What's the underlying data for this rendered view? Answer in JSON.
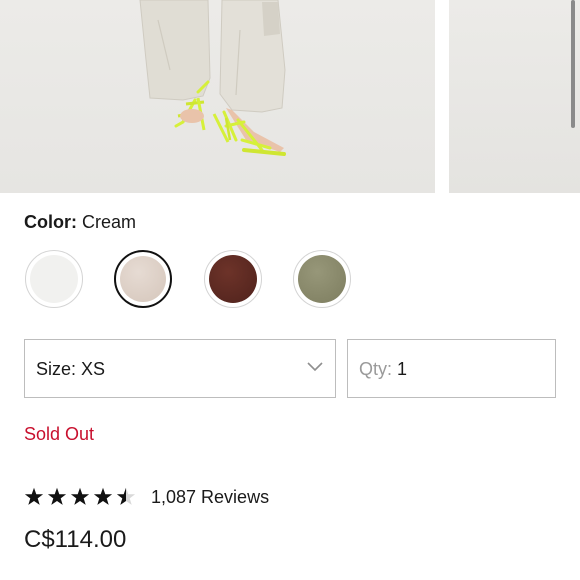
{
  "product": {
    "color_label": "Color:",
    "color_value": "Cream",
    "swatches": [
      {
        "name": "white",
        "color": "#f1f1ef"
      },
      {
        "name": "cream",
        "color": "#ddd0c7",
        "selected": true
      },
      {
        "name": "brown",
        "color": "#5c2a22"
      },
      {
        "name": "olive",
        "color": "#8a8a6c"
      }
    ],
    "size_label": "Size:",
    "size_value": "XS",
    "qty_label": "Qty:",
    "qty_value": "1",
    "status": "Sold Out",
    "rating": 4.5,
    "reviews": "1,087 Reviews",
    "price": "C$114.00"
  },
  "colors": {
    "accent_red": "#c8102e",
    "sandal_neon": "#d6f03a",
    "pants_cream": "#dedbd2"
  }
}
